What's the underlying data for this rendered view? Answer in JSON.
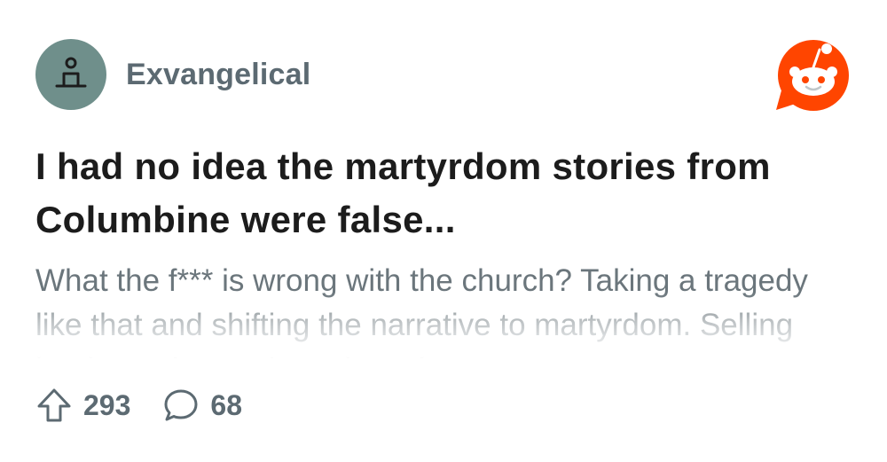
{
  "post": {
    "subreddit": "Exvangelical",
    "title": "I had no idea the martyrdom stories from Columbine were false...",
    "body": "What the f*** is wrong with the church? Taking a tragedy like that and shifting the narrative to martyrdom. Selling books and records and seminars",
    "upvotes": "293",
    "comments": "68"
  },
  "icons": {
    "avatar": "candle-icon",
    "logo": "reddit-snoo-icon",
    "upvote": "arrow-up-icon",
    "comment": "speech-bubble-icon"
  },
  "colors": {
    "avatar_bg": "#6f8f8b",
    "reddit_orange": "#ff4500",
    "title_text": "#1c1c1c",
    "muted_text": "#5c6a72"
  }
}
